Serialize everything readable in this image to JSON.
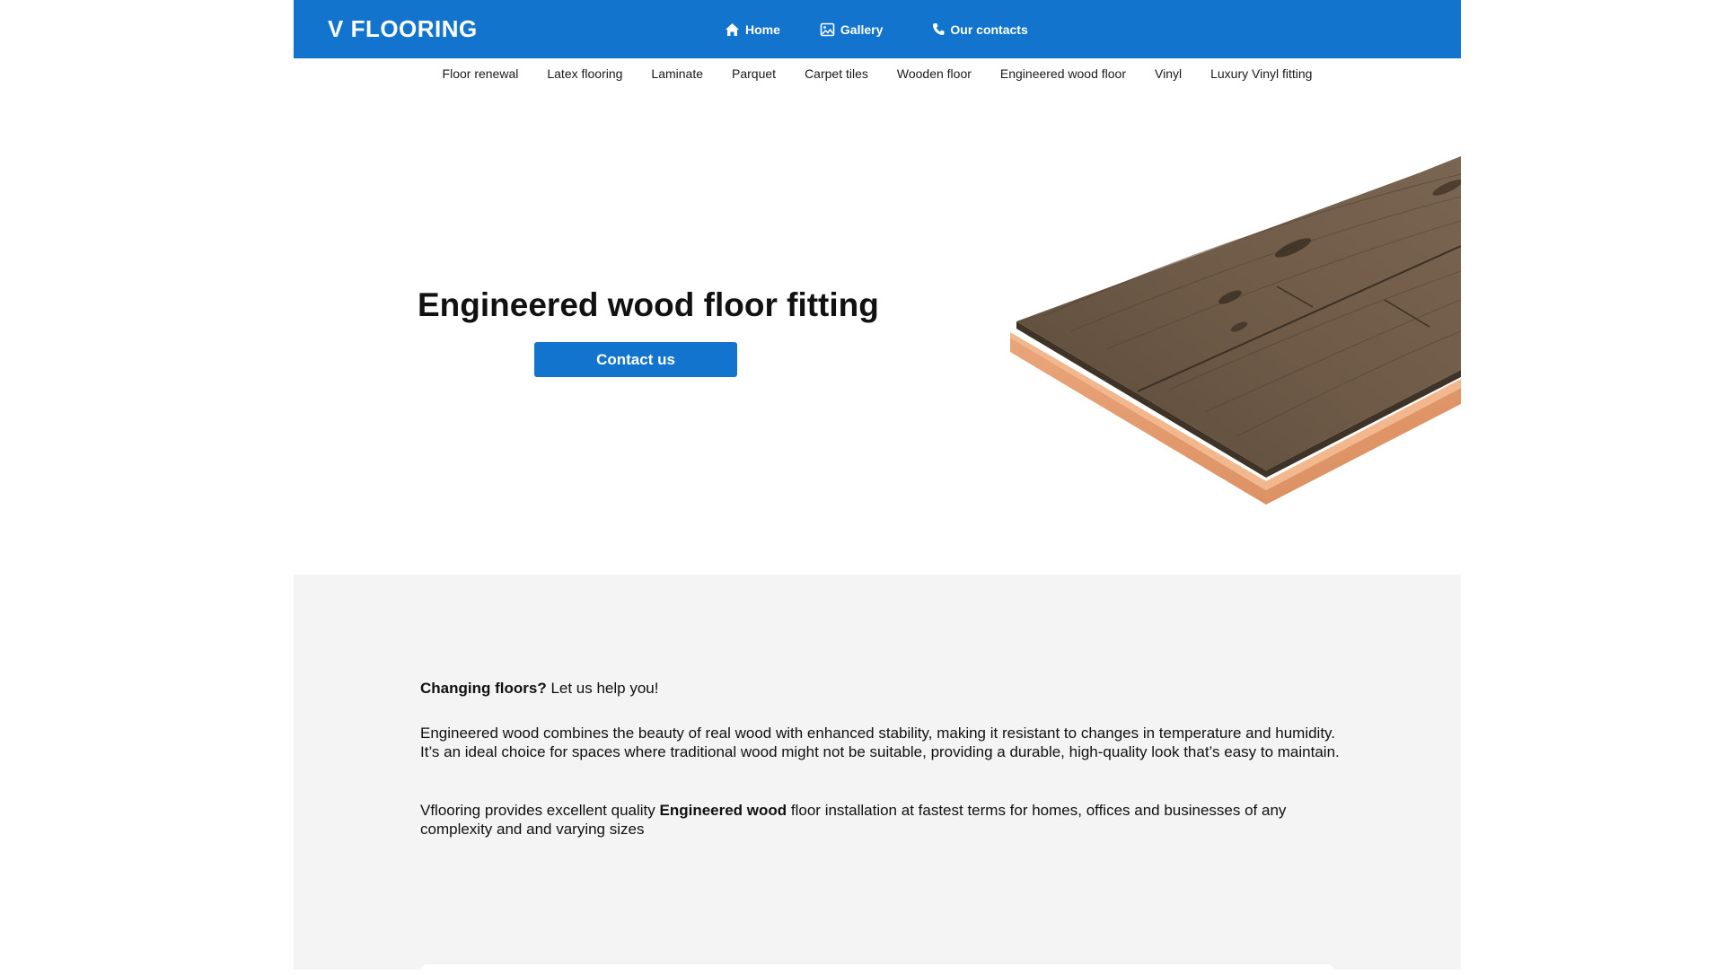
{
  "header": {
    "logo": "V FLOORING",
    "brand_color": "#1274cc",
    "nav": [
      {
        "label": "Home",
        "icon": "home-icon"
      },
      {
        "label": "Gallery",
        "icon": "image-icon"
      },
      {
        "label": "Our contacts",
        "icon": "phone-icon"
      }
    ]
  },
  "subnav": {
    "items": [
      "Floor renewal",
      "Latex flooring",
      "Laminate",
      "Parquet",
      "Carpet tiles",
      "Wooden floor",
      "Engineered wood floor",
      "Vinyl",
      "Luxury Vinyl fitting"
    ]
  },
  "hero": {
    "title": "Engineered wood floor fitting",
    "cta_label": "Contact us",
    "image": "engineered-wood-plank-image"
  },
  "content": {
    "lead_bold": "Changing floors?",
    "lead_rest": " Let us help you!",
    "paragraph1": "Engineered wood combines the beauty of real wood with enhanced stability, making it resistant to changes in temperature and humidity. It’s an ideal choice for spaces where traditional wood might not be suitable, providing a durable, high-quality look that’s easy to maintain.",
    "paragraph2_start": "Vflooring provides excellent quality ",
    "paragraph2_bold": "Engineered wood",
    "paragraph2_end": " floor installation at fastest terms for homes, offices and businesses of any complexity and and varying sizes"
  }
}
